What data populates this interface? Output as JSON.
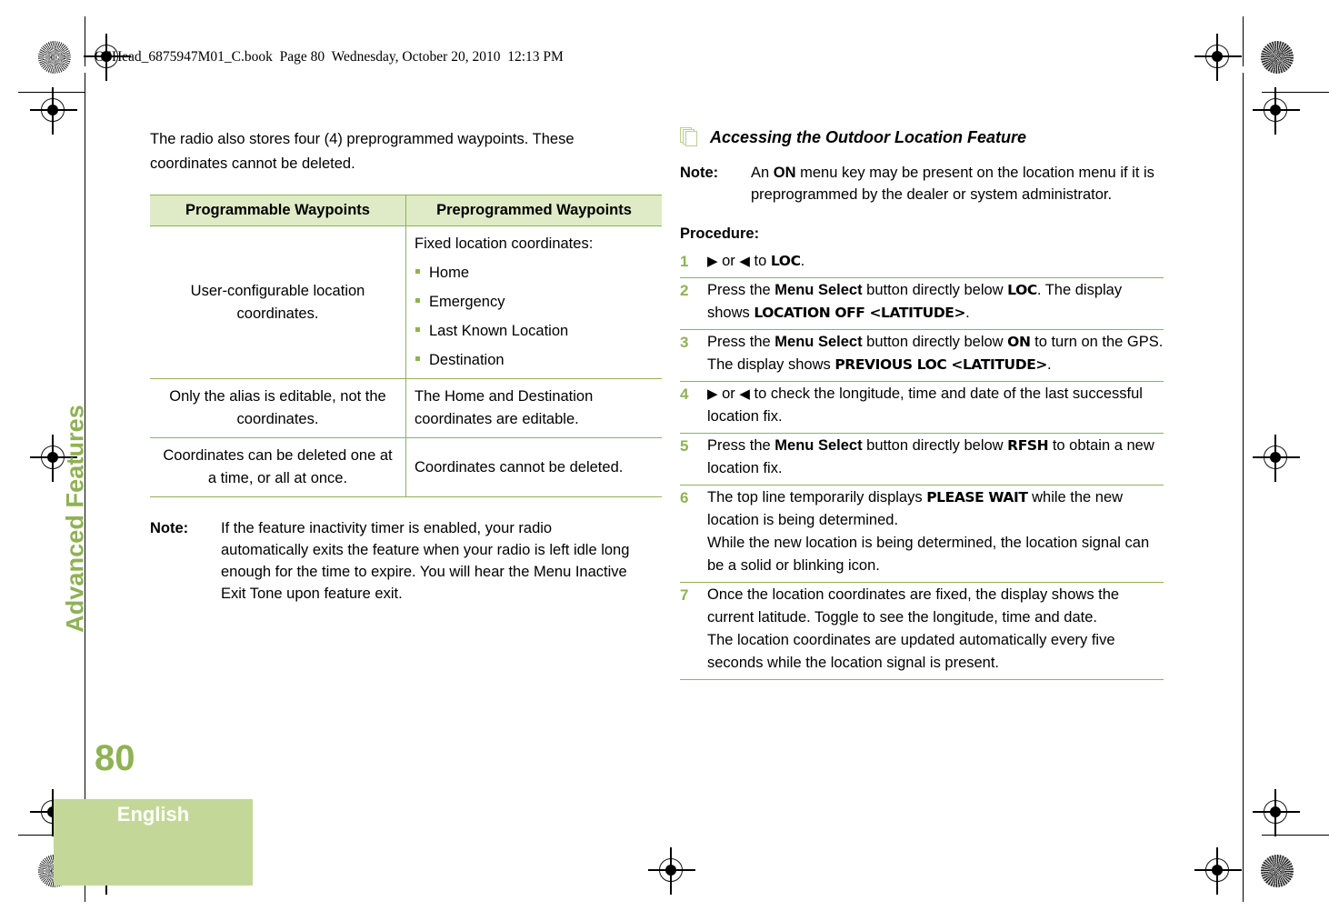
{
  "header_slug": "O5Head_6875947M01_C.book  Page 80  Wednesday, October 20, 2010  12:13 PM",
  "sidebar": {
    "chapter_label": "Advanced Features",
    "page_number": "80",
    "language": "English"
  },
  "colors": {
    "accent_green": "#8fb254",
    "table_header_bg": "#dfebc6",
    "language_block_bg": "#c3d898",
    "icon_outline": "#b9d08f"
  },
  "left_column": {
    "intro_paragraph": "The radio also stores four (4) preprogrammed waypoints. These coordinates cannot be deleted.",
    "table": {
      "headers": [
        "Programmable Waypoints",
        "Preprogrammed Waypoints"
      ],
      "rows": [
        {
          "col1": "User-configurable location coordinates.",
          "col2_intro": "Fixed location coordinates:",
          "col2_bullets": [
            "Home",
            "Emergency",
            "Last Known Location",
            "Destination"
          ]
        },
        {
          "col1": "Only the alias is editable, not the coordinates.",
          "col2_intro": "The Home and Destination coordinates are editable.",
          "col2_bullets": []
        },
        {
          "col1": "Coordinates can be deleted one at a time, or all at once.",
          "col2_intro": "Coordinates cannot be deleted.",
          "col2_bullets": []
        }
      ]
    },
    "note": {
      "label": "Note:",
      "text": "If the feature inactivity timer is enabled, your radio automatically exits the feature when your radio is left idle long enough for the time to expire. You will hear the Menu Inactive Exit Tone upon feature exit."
    }
  },
  "right_column": {
    "section_title": "Accessing the Outdoor Location Feature",
    "note": {
      "label": "Note:",
      "text_before": "An ",
      "bold_term": "ON",
      "text_after": " menu key may be present on the location menu if it is preprogrammed by the dealer or system administrator."
    },
    "procedure_label": "Procedure:",
    "steps": [
      {
        "number": "1",
        "segments": [
          {
            "t": "arrow-right",
            "v": "▶"
          },
          {
            "t": "plain",
            "v": " or "
          },
          {
            "t": "arrow-left",
            "v": "◀"
          },
          {
            "t": "plain",
            "v": " to "
          },
          {
            "t": "display",
            "v": "LOC"
          },
          {
            "t": "plain",
            "v": "."
          }
        ]
      },
      {
        "number": "2",
        "segments": [
          {
            "t": "plain",
            "v": "Press the "
          },
          {
            "t": "bold",
            "v": "Menu Select"
          },
          {
            "t": "plain",
            "v": " button directly below "
          },
          {
            "t": "display",
            "v": "LOC"
          },
          {
            "t": "plain",
            "v": ". The display shows "
          },
          {
            "t": "display",
            "v": "LOCATION OFF <LATITUDE>"
          },
          {
            "t": "plain",
            "v": "."
          }
        ]
      },
      {
        "number": "3",
        "segments": [
          {
            "t": "plain",
            "v": "Press the "
          },
          {
            "t": "bold",
            "v": "Menu Select"
          },
          {
            "t": "plain",
            "v": " button directly below "
          },
          {
            "t": "display",
            "v": "ON"
          },
          {
            "t": "plain",
            "v": " to turn on the GPS. The display shows "
          },
          {
            "t": "display",
            "v": "PREVIOUS LOC <LATITUDE>"
          },
          {
            "t": "plain",
            "v": "."
          }
        ]
      },
      {
        "number": "4",
        "segments": [
          {
            "t": "arrow-right",
            "v": "▶"
          },
          {
            "t": "plain",
            "v": " or "
          },
          {
            "t": "arrow-left",
            "v": "◀"
          },
          {
            "t": "plain",
            "v": " to check the longitude, time and date of the last successful location fix."
          }
        ]
      },
      {
        "number": "5",
        "segments": [
          {
            "t": "plain",
            "v": "Press the "
          },
          {
            "t": "bold",
            "v": "Menu Select"
          },
          {
            "t": "plain",
            "v": " button directly below "
          },
          {
            "t": "display",
            "v": "RFSH"
          },
          {
            "t": "plain",
            "v": " to obtain a new location fix."
          }
        ]
      },
      {
        "number": "6",
        "segments": [
          {
            "t": "plain",
            "v": "The top line temporarily displays "
          },
          {
            "t": "display",
            "v": "PLEASE WAIT"
          },
          {
            "t": "plain",
            "v": " while the new location is being determined."
          },
          {
            "t": "break",
            "v": ""
          },
          {
            "t": "plain",
            "v": "While the new location is being determined, the location signal can be a solid or blinking icon."
          }
        ]
      },
      {
        "number": "7",
        "segments": [
          {
            "t": "plain",
            "v": "Once the location coordinates are fixed, the display shows the current latitude. Toggle to see the longitude, time and date."
          },
          {
            "t": "break",
            "v": ""
          },
          {
            "t": "plain",
            "v": "The location coordinates are updated automatically every five seconds while the location signal is present."
          }
        ]
      }
    ]
  }
}
